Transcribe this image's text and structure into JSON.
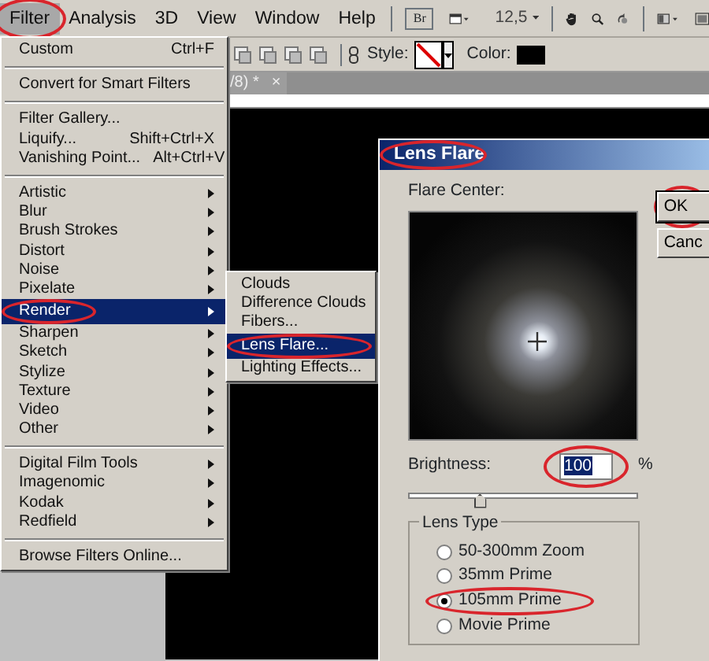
{
  "menubar": [
    {
      "label": "Filter",
      "selected": true,
      "circled": true
    },
    {
      "label": "Analysis",
      "selected": false,
      "circled": false
    },
    {
      "label": "3D",
      "selected": false,
      "circled": false
    },
    {
      "label": "View",
      "selected": false,
      "circled": false
    },
    {
      "label": "Window",
      "selected": false,
      "circled": false
    },
    {
      "label": "Help",
      "selected": false,
      "circled": false
    }
  ],
  "app_bar": {
    "bridge_label": "Br",
    "zoom": "12,5"
  },
  "options_bar": {
    "style_label": "Style:",
    "color_label": "Color:"
  },
  "document_tab": {
    "title": "/8) *",
    "close": "×"
  },
  "filter_menu": [
    [
      {
        "label": "Custom",
        "shortcut": "Ctrl+F",
        "submenu": false,
        "selected": false,
        "circled": false
      }
    ],
    [
      {
        "label": "Convert for Smart Filters",
        "submenu": false,
        "selected": false,
        "circled": false
      }
    ],
    [
      {
        "label": "Filter Gallery...",
        "submenu": false,
        "selected": false,
        "circled": false
      },
      {
        "label": "Liquify...",
        "shortcut": "Shift+Ctrl+X",
        "submenu": false,
        "selected": false,
        "circled": false
      },
      {
        "label": "Vanishing Point...",
        "shortcut": "Alt+Ctrl+V",
        "submenu": false,
        "selected": false,
        "circled": false
      }
    ],
    [
      {
        "label": "Artistic",
        "submenu": true,
        "selected": false,
        "circled": false
      },
      {
        "label": "Blur",
        "submenu": true,
        "selected": false,
        "circled": false
      },
      {
        "label": "Brush Strokes",
        "submenu": true,
        "selected": false,
        "circled": false
      },
      {
        "label": "Distort",
        "submenu": true,
        "selected": false,
        "circled": false
      },
      {
        "label": "Noise",
        "submenu": true,
        "selected": false,
        "circled": false
      },
      {
        "label": "Pixelate",
        "submenu": true,
        "selected": false,
        "circled": false
      },
      {
        "label": "Render",
        "submenu": true,
        "selected": true,
        "circled": true
      },
      {
        "label": "Sharpen",
        "submenu": true,
        "selected": false,
        "circled": false
      },
      {
        "label": "Sketch",
        "submenu": true,
        "selected": false,
        "circled": false
      },
      {
        "label": "Stylize",
        "submenu": true,
        "selected": false,
        "circled": false
      },
      {
        "label": "Texture",
        "submenu": true,
        "selected": false,
        "circled": false
      },
      {
        "label": "Video",
        "submenu": true,
        "selected": false,
        "circled": false
      },
      {
        "label": "Other",
        "submenu": true,
        "selected": false,
        "circled": false
      }
    ],
    [
      {
        "label": "Digital Film Tools",
        "submenu": true,
        "selected": false,
        "circled": false
      },
      {
        "label": "Imagenomic",
        "submenu": true,
        "selected": false,
        "circled": false
      },
      {
        "label": "Kodak",
        "submenu": true,
        "selected": false,
        "circled": false
      },
      {
        "label": "Redfield",
        "submenu": true,
        "selected": false,
        "circled": false
      }
    ],
    [
      {
        "label": "Browse Filters Online...",
        "submenu": false,
        "selected": false,
        "circled": false
      }
    ]
  ],
  "render_submenu": [
    {
      "label": "Clouds",
      "selected": false,
      "circled": false
    },
    {
      "label": "Difference Clouds",
      "selected": false,
      "circled": false
    },
    {
      "label": "Fibers...",
      "selected": false,
      "circled": false
    },
    {
      "label": "Lens Flare...",
      "selected": true,
      "circled": true
    },
    {
      "label": "Lighting Effects...",
      "selected": false,
      "circled": false
    }
  ],
  "dialog": {
    "title": "Lens Flare",
    "title_circled": true,
    "flare_center_label": "Flare Center:",
    "buttons": [
      {
        "label": "OK",
        "circled": true
      },
      {
        "label": "Canc",
        "circled": false
      }
    ],
    "brightness": {
      "label": "Brightness:",
      "value": "100",
      "value_highlighted": true,
      "circled": true,
      "unit": "%",
      "level": 0.31
    },
    "lens_type": {
      "legend": "Lens Type",
      "options": [
        {
          "label": "50-300mm Zoom",
          "selected": false,
          "circled": false
        },
        {
          "label": "35mm Prime",
          "selected": false,
          "circled": false
        },
        {
          "label": "105mm Prime",
          "selected": true,
          "circled": true
        },
        {
          "label": "Movie Prime",
          "selected": false,
          "circled": false
        }
      ]
    }
  }
}
